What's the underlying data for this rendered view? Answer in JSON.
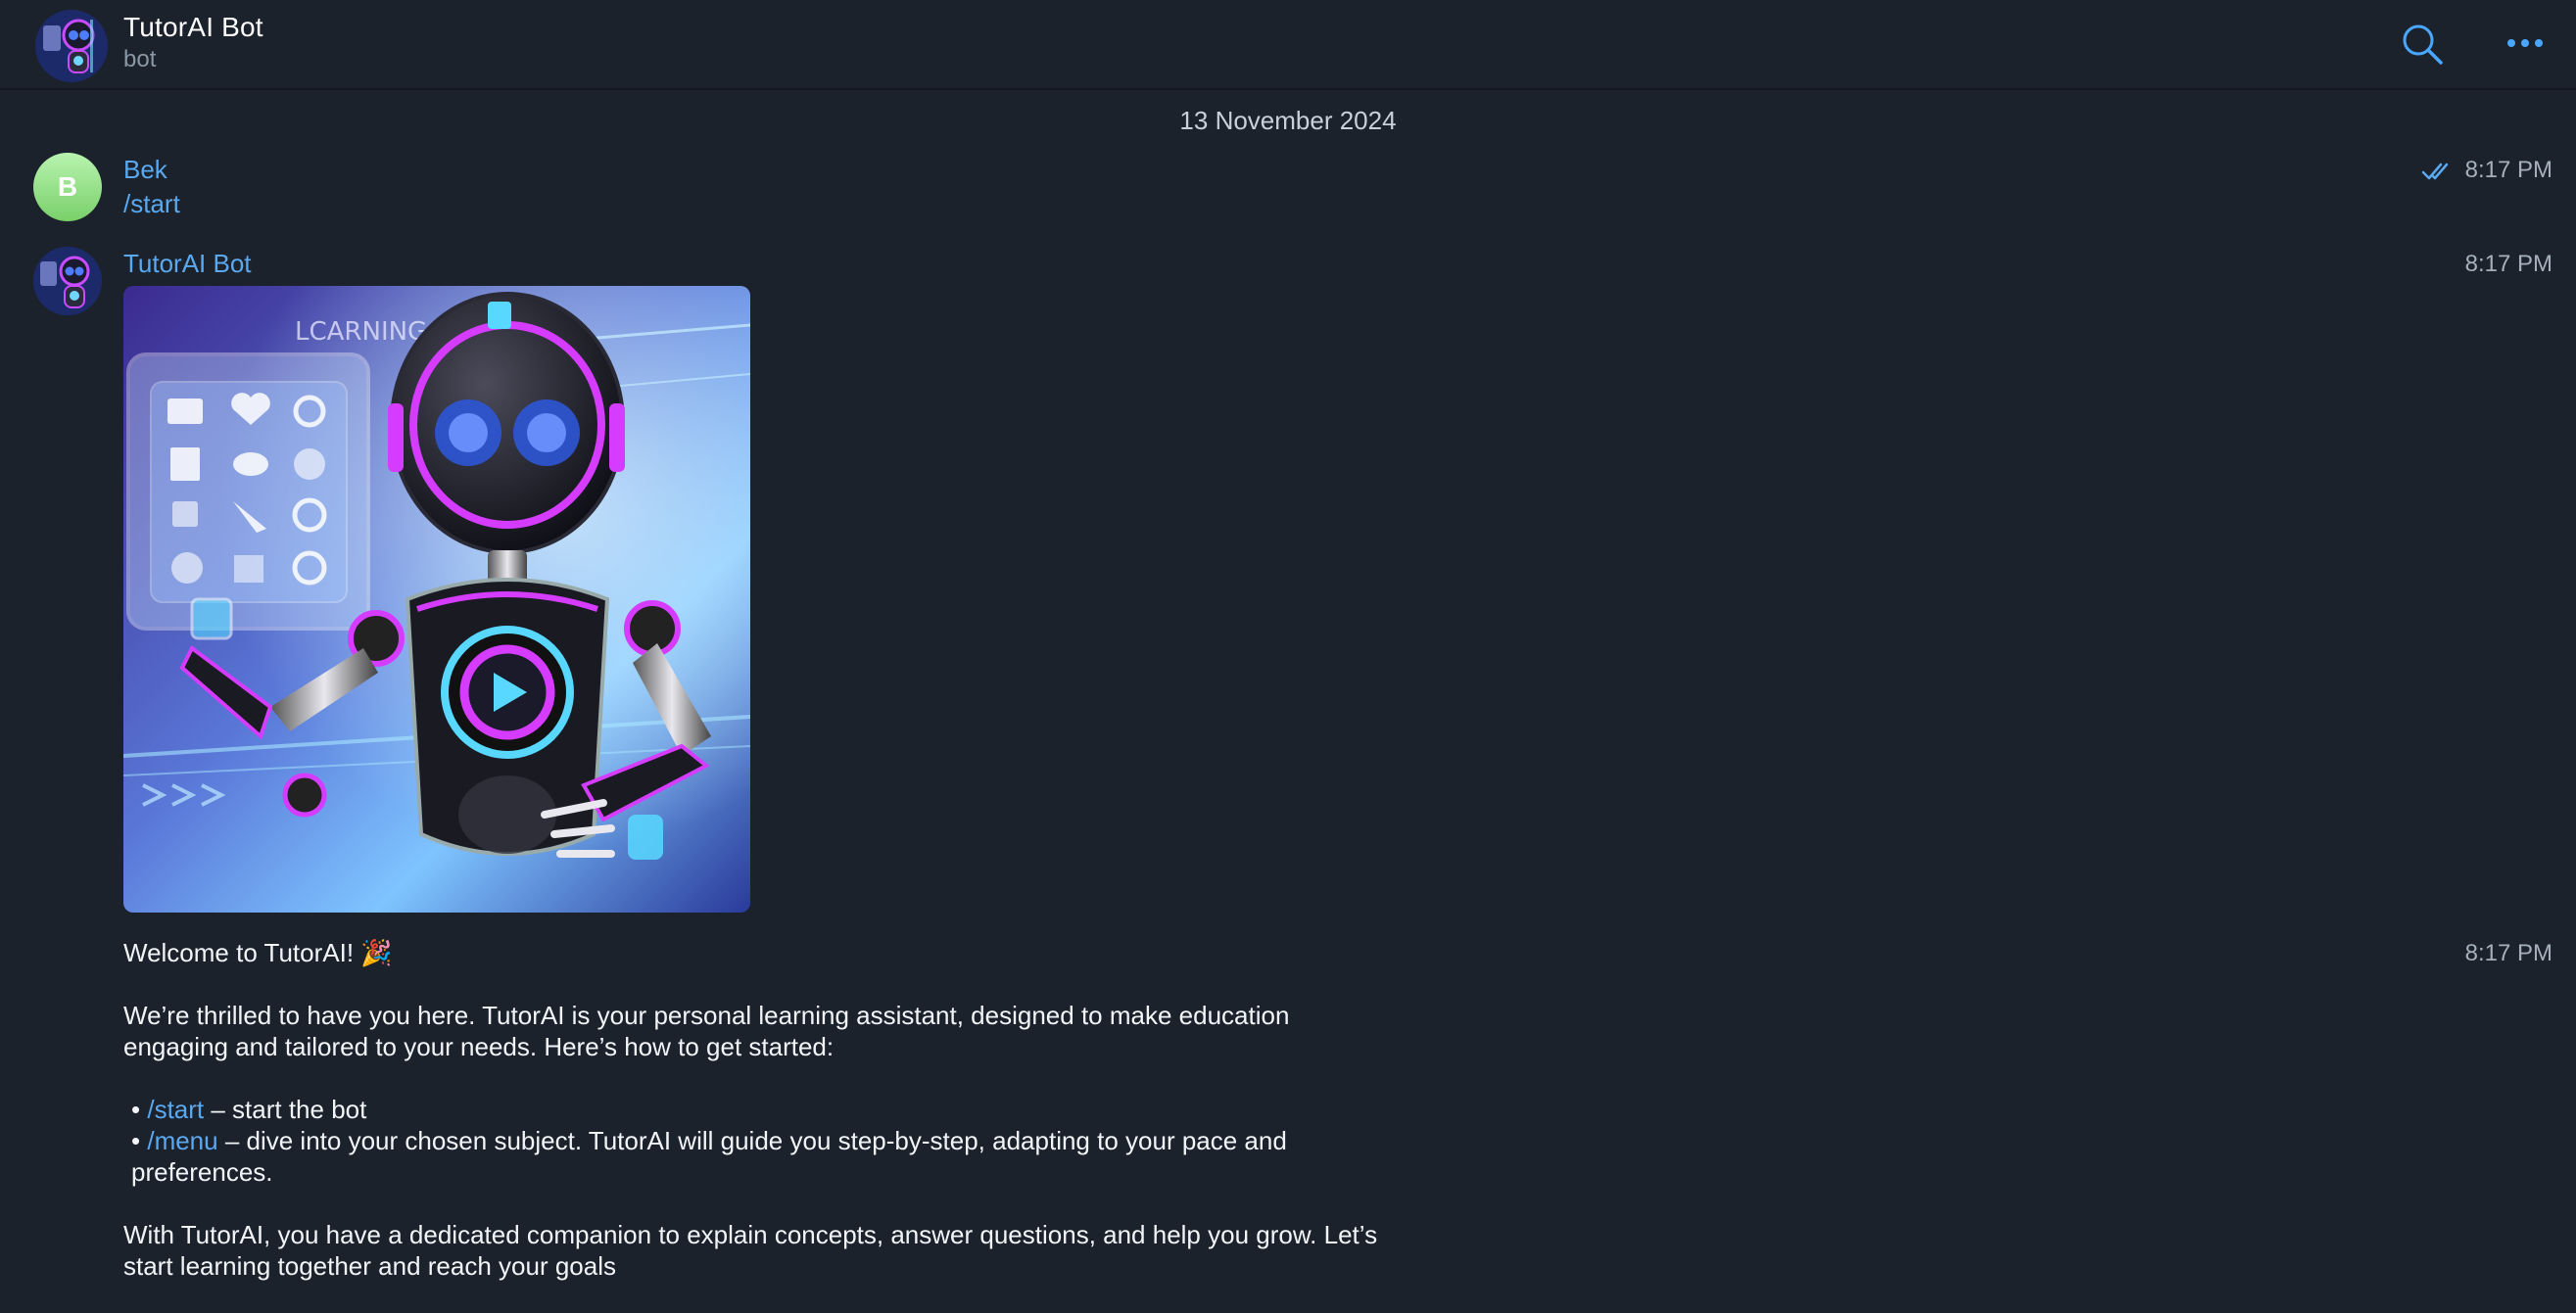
{
  "header": {
    "title": "TutorAI Bot",
    "subtitle": "bot",
    "search_icon": "search-icon",
    "more_icon": "more-horizontal-icon",
    "avatar_icon": "robot-avatar-icon"
  },
  "date_separator": "13 November 2024",
  "messages": [
    {
      "sender": "Bek",
      "avatar_letter": "B",
      "avatar_color": "#9be68f",
      "text": "/start",
      "time": "8:17 PM",
      "status_icon": "double-check-icon"
    },
    {
      "sender": "TutorAI Bot",
      "time_image": "8:17 PM",
      "image_icon": "robot-learning-illustration",
      "image_text": "LCARNING",
      "time_text": "8:17 PM",
      "welcome": "Welcome to TutorAI! 🎉",
      "intro": "We’re thrilled to have you here. TutorAI is your personal learning assistant, designed to make education engaging and tailored to your needs. Here’s how to get started:",
      "bullets": [
        {
          "prefix": "•",
          "command": "/start",
          "text": " – start the bot"
        },
        {
          "prefix": "•",
          "command": "/menu",
          "text": " – dive into your chosen subject. TutorAI will guide you step-by-step, adapting to your pace and preferences."
        }
      ],
      "closing": "With TutorAI, you have a dedicated companion to explain concepts, answer questions, and help you grow. Let’s start learning together and reach your goals"
    }
  ],
  "colors": {
    "background": "#1b222c",
    "accent": "#5aa9f0",
    "muted": "#a6b0bc"
  }
}
